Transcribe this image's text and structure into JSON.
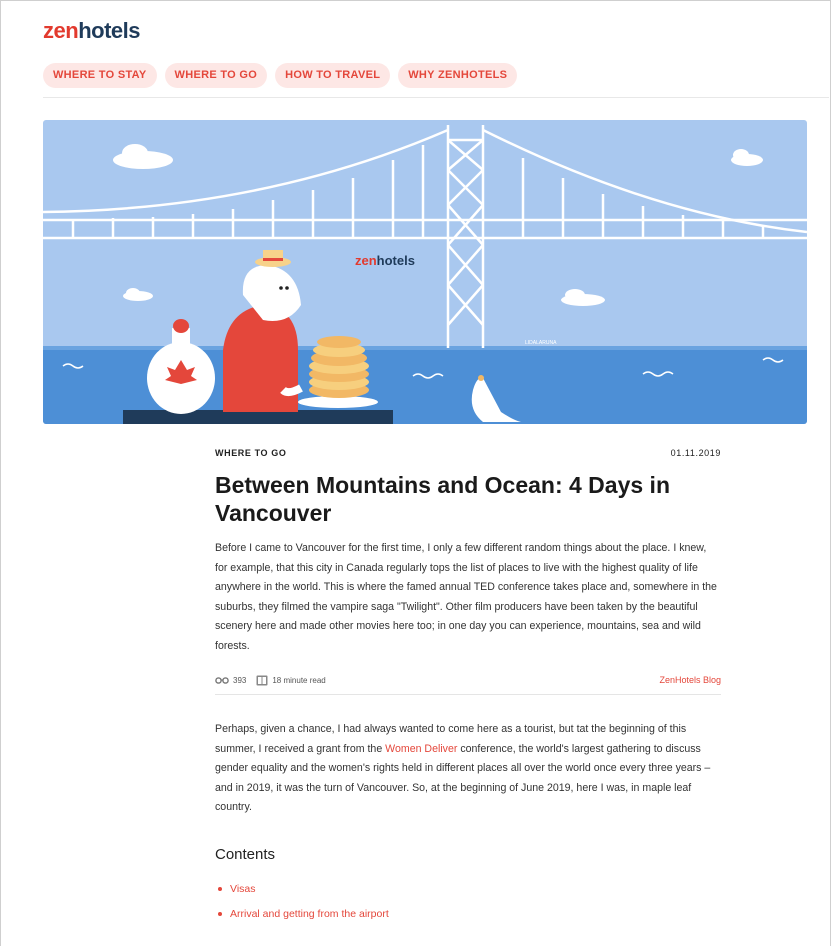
{
  "header": {
    "logo_zen": "zen",
    "logo_hotels": "hotels",
    "nav": [
      "WHERE TO STAY",
      "WHERE TO GO",
      "HOW TO TRAVEL",
      "WHY ZENHOTELS"
    ]
  },
  "hero": {
    "logo_zen": "zen",
    "logo_hotels": "hotels",
    "signature": "LIDALARUNA"
  },
  "article": {
    "category": "WHERE TO GO",
    "date": "01.11.2019",
    "title": "Between Mountains and Ocean: 4 Days in Vancouver",
    "intro": "Before I came to Vancouver for the first time, I only a few different random things about the place. I knew, for example, that this city in Canada regularly tops the list of places to live with the highest quality of life anywhere in the world. This is where the famed annual TED conference takes place and, somewhere in the suburbs, they filmed the vampire saga \"Twilight\". Other film producers have been taken by the beautiful scenery here and made other movies here too; in one day you can experience, mountains, sea and wild forests.",
    "views": "393",
    "read_time": "18 minute read",
    "blog_link": "ZenHotels Blog",
    "body_part1": "Perhaps, given a chance, I had always wanted to come here as a tourist, but tat the beginning of this summer, I received a grant from the ",
    "body_link": "Women Deliver",
    "body_part2": " conference, the world's largest gathering to discuss gender equality and the women's rights held in different places all over the world once every three years – and in 2019, it was the turn of Vancouver. So, at the beginning of June 2019, here I was, in maple leaf country.",
    "contents_title": "Contents",
    "contents": [
      "Visas",
      "Arrival and getting from the airport"
    ]
  },
  "colors": {
    "accent": "#e4473b",
    "brand_dark": "#1f3b5a",
    "pill_bg": "#fde7e5",
    "sky": "#a9c8ef",
    "sea": "#4d8fd6"
  }
}
